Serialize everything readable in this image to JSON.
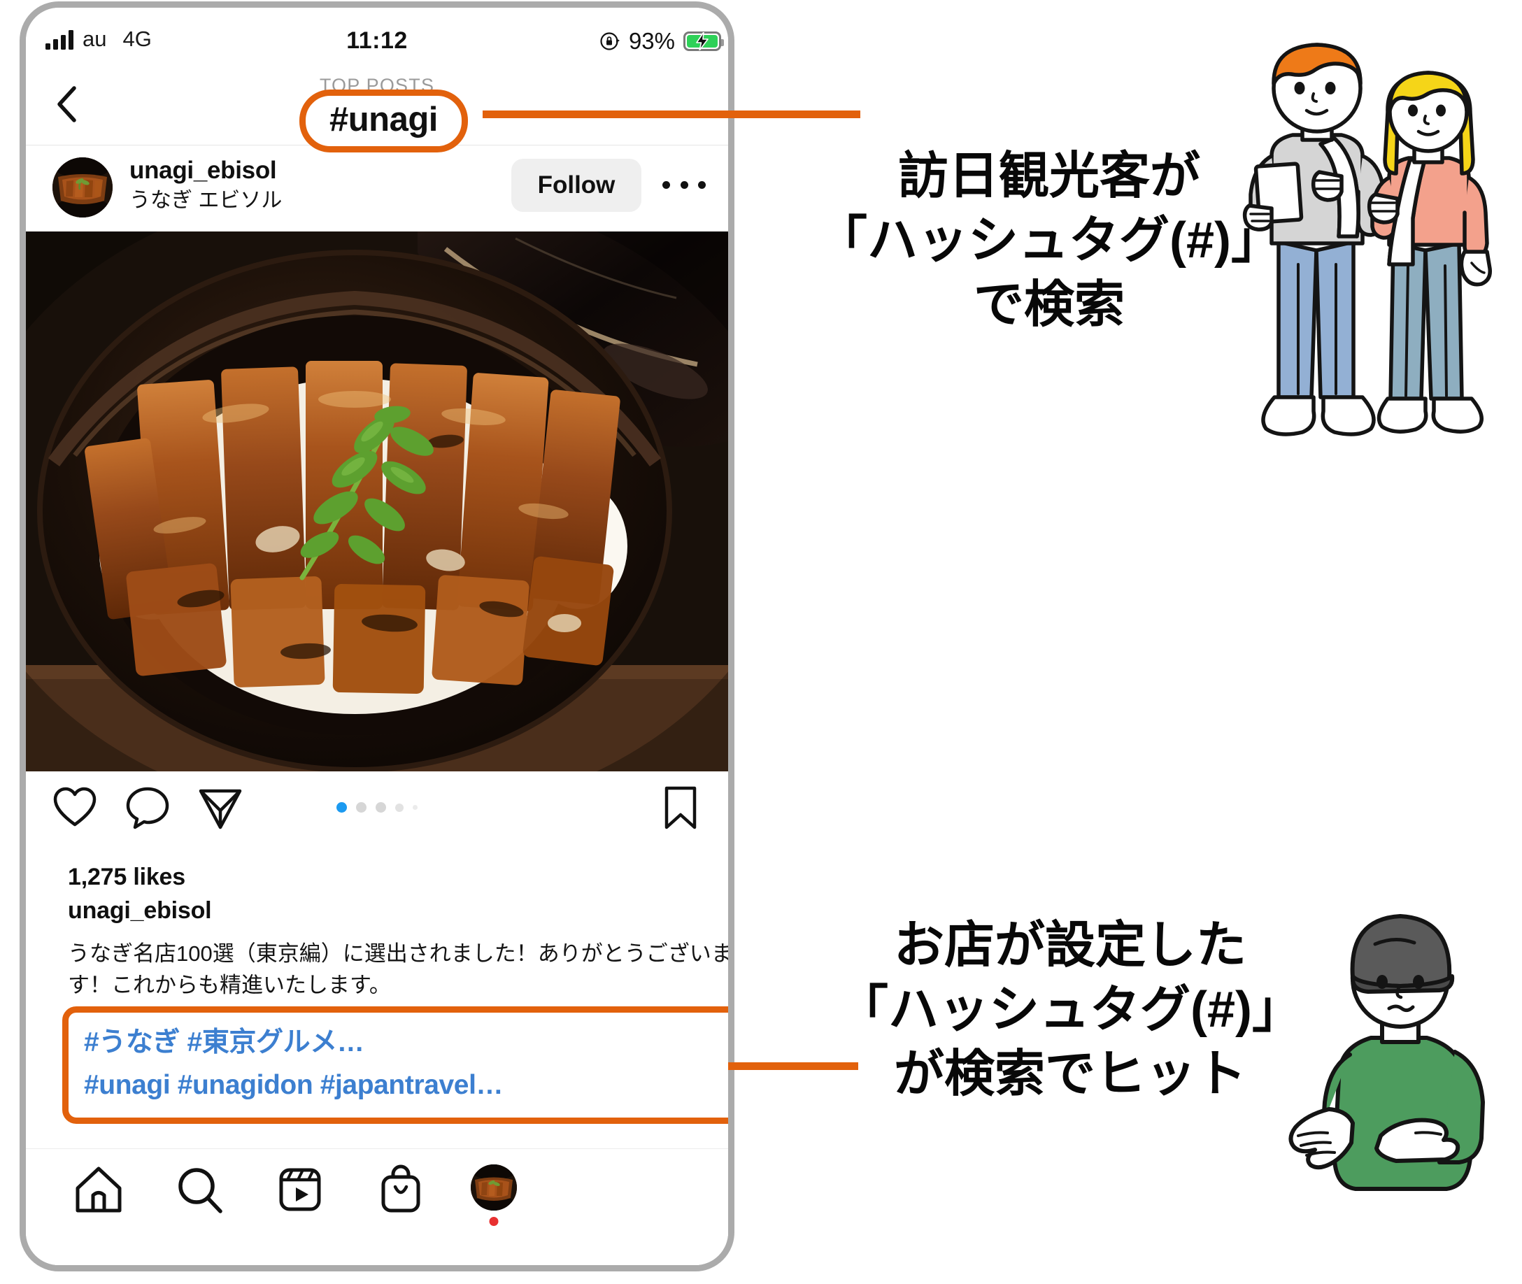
{
  "status_bar": {
    "carrier": "au",
    "network": "4G",
    "time": "11:12",
    "battery_percent": "93%",
    "battery_level": 93,
    "rotation_lock_icon": "rotation-lock-icon",
    "signal_icon": "signal-bars-icon",
    "battery_icon": "battery-charging-icon"
  },
  "nav_header": {
    "back_icon": "back-chevron-icon",
    "top_label": "TOP POSTS",
    "hashtag_title": "#unagi"
  },
  "post_header": {
    "username": "unagi_ebisol",
    "subtitle": "うなぎ エビソル",
    "follow_label": "Follow",
    "more_icon": "more-options-icon",
    "avatar_icon": "profile-avatar"
  },
  "post_media": {
    "alt_name": "unagi-donburi-photo"
  },
  "actions": {
    "like_icon": "heart-icon",
    "comment_icon": "comment-bubble-icon",
    "share_icon": "share-paperplane-icon",
    "save_icon": "bookmark-icon",
    "carousel_dot_count": 5,
    "carousel_active_index": 1
  },
  "caption": {
    "likes": "1,275 likes",
    "username": "unagi_ebisol",
    "text": "うなぎ名店100選（東京編）に選出されました！ありがとうございます！これからも精進いたします。"
  },
  "hashtags": {
    "line1": "#うなぎ #東京グルメ…",
    "line2": "#unagi #unagidon #japantravel…"
  },
  "bottom_nav": {
    "items": [
      {
        "name": "home",
        "icon": "home-icon"
      },
      {
        "name": "search",
        "icon": "search-icon"
      },
      {
        "name": "reels",
        "icon": "reels-icon"
      },
      {
        "name": "shop",
        "icon": "shop-bag-icon"
      },
      {
        "name": "profile",
        "icon": "profile-avatar-icon"
      }
    ],
    "profile_badge": "unread-dot"
  },
  "annotations": {
    "top": {
      "line1": "訪日観光客が",
      "line2": "「ハッシュタグ(#)」",
      "line3": "で検索"
    },
    "bottom": {
      "line1": "お店が設定した",
      "line2": "「ハッシュタグ(#)」",
      "line3": "が検索でヒット"
    }
  },
  "characters": {
    "tourist_pair": "tourist-couple-illustration",
    "shop_owner": "shop-owner-illustration"
  },
  "colors": {
    "accent_orange": "#e2610c",
    "hashtag_blue": "#3c7fd0",
    "carousel_active_blue": "#1c9af0",
    "battery_green": "#2ed158",
    "follow_bg": "#efefef",
    "phone_frame": "#ababab",
    "badge_red": "#e83030"
  }
}
